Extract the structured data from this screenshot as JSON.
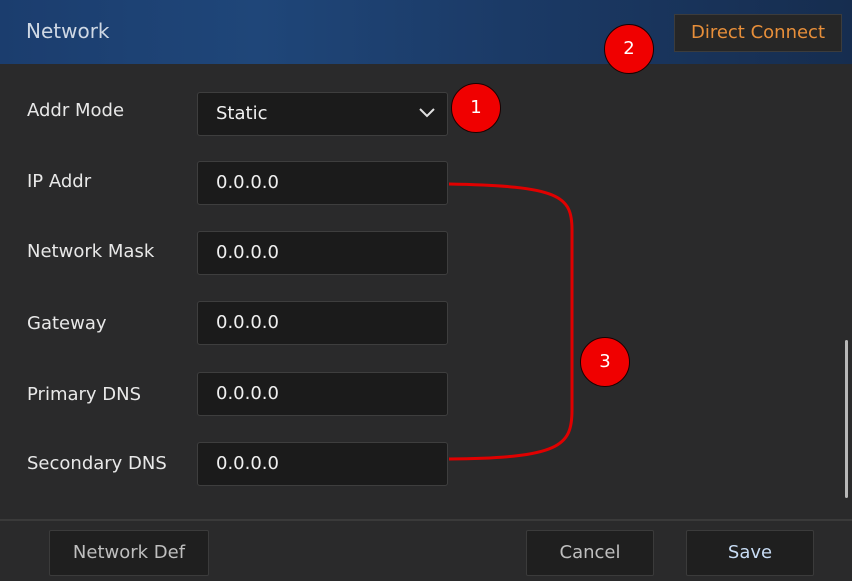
{
  "header": {
    "title": "Network",
    "direct_connect_label": "Direct Connect"
  },
  "form": {
    "addr_mode": {
      "label": "Addr Mode",
      "value": "Static"
    },
    "ip_addr": {
      "label": "IP Addr",
      "value": "0.0.0.0"
    },
    "network_mask": {
      "label": "Network Mask",
      "value": "0.0.0.0"
    },
    "gateway": {
      "label": "Gateway",
      "value": "0.0.0.0"
    },
    "primary_dns": {
      "label": "Primary DNS",
      "value": "0.0.0.0"
    },
    "secondary_dns": {
      "label": "Secondary DNS",
      "value": "0.0.0.0"
    }
  },
  "annotations": {
    "badge_1": "1",
    "badge_2": "2",
    "badge_3": "3"
  },
  "footer": {
    "network_def_label": "Network Def",
    "cancel_label": "Cancel",
    "save_label": "Save"
  },
  "colors": {
    "accent_orange": "#e88f3a",
    "badge_red": "#f00000",
    "header_blue": "#1f4679"
  },
  "icons": {
    "dropdown": "chevron-down-icon"
  }
}
